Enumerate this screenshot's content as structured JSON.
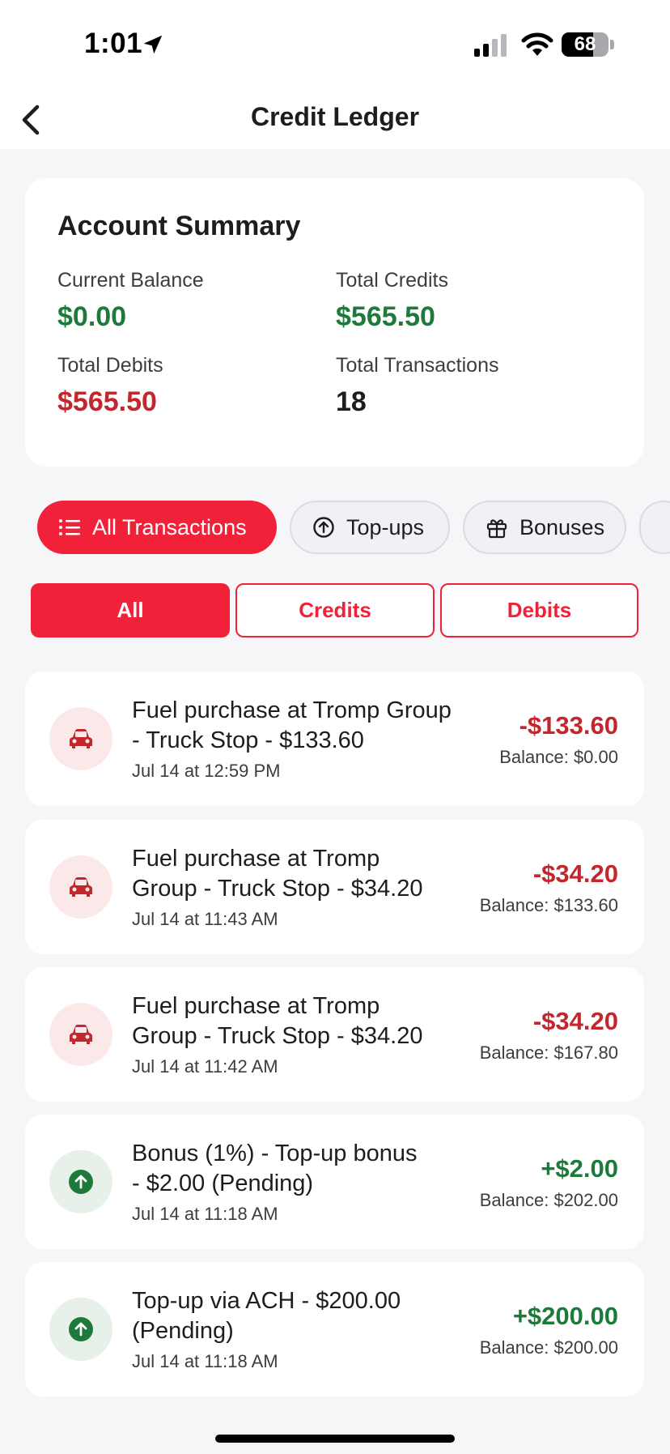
{
  "status_bar": {
    "time": "1:01",
    "battery": "68",
    "battery_level_percent": 68
  },
  "nav": {
    "title": "Credit Ledger"
  },
  "summary": {
    "title": "Account Summary",
    "current_balance_label": "Current Balance",
    "current_balance": "$0.00",
    "total_credits_label": "Total Credits",
    "total_credits": "$565.50",
    "total_debits_label": "Total Debits",
    "total_debits": "$565.50",
    "total_transactions_label": "Total Transactions",
    "total_transactions": "18"
  },
  "filters": {
    "chips": [
      {
        "label": "All Transactions",
        "icon": "list-icon",
        "active": true
      },
      {
        "label": "Top-ups",
        "icon": "arrow-up-circle-icon",
        "active": false
      },
      {
        "label": "Bonuses",
        "icon": "gift-icon",
        "active": false
      }
    ],
    "segments": [
      {
        "label": "All",
        "active": true
      },
      {
        "label": "Credits",
        "active": false
      },
      {
        "label": "Debits",
        "active": false
      }
    ]
  },
  "colors": {
    "accent": "#f02139",
    "credit_green": "#1e7a3a",
    "debit_red": "#c2272d"
  },
  "transactions": [
    {
      "line1": "Fuel purchase at Tromp Group",
      "line2": "- Truck Stop - $133.60",
      "date": "Jul 14 at 12:59 PM",
      "amount": "-$133.60",
      "balance": "Balance: $0.00",
      "type": "debit",
      "icon": "car-icon"
    },
    {
      "line1": "Fuel purchase at Tromp",
      "line2": "Group - Truck Stop - $34.20",
      "date": "Jul 14 at 11:43 AM",
      "amount": "-$34.20",
      "balance": "Balance: $133.60",
      "type": "debit",
      "icon": "car-icon"
    },
    {
      "line1": "Fuel purchase at Tromp",
      "line2": "Group - Truck Stop - $34.20",
      "date": "Jul 14 at 11:42 AM",
      "amount": "-$34.20",
      "balance": "Balance: $167.80",
      "type": "debit",
      "icon": "car-icon"
    },
    {
      "line1": "Bonus (1%) - Top-up bonus",
      "line2": "- $2.00 (Pending)",
      "date": "Jul 14 at 11:18 AM",
      "amount": "+$2.00",
      "balance": "Balance: $202.00",
      "type": "credit",
      "icon": "arrow-up-circle-icon"
    },
    {
      "line1": "Top-up via ACH - $200.00",
      "line2": "(Pending)",
      "date": "Jul 14 at 11:18 AM",
      "amount": "+$200.00",
      "balance": "Balance: $200.00",
      "type": "credit",
      "icon": "arrow-up-circle-icon"
    }
  ]
}
